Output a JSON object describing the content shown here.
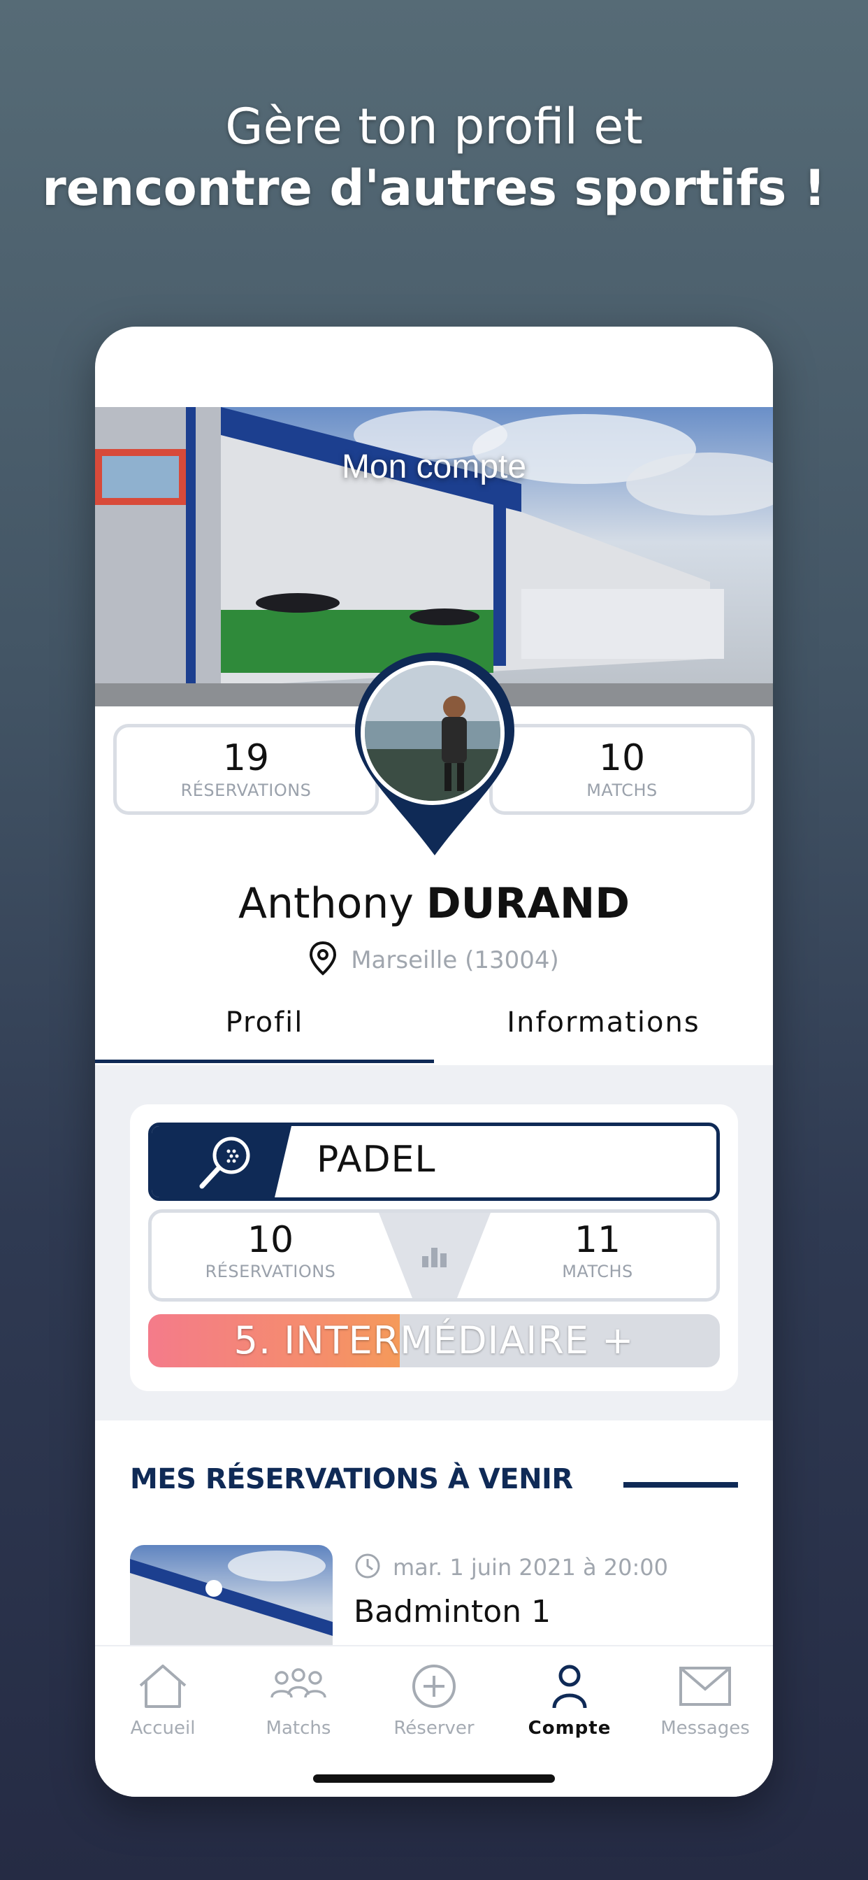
{
  "headline": {
    "line1": "Gère ton profil et",
    "line2": "rencontre d'autres sportifs !"
  },
  "cover": {
    "title": "Mon compte"
  },
  "stats": {
    "reservations": {
      "value": "19",
      "label": "RÉSERVATIONS"
    },
    "matchs": {
      "value": "10",
      "label": "MATCHS"
    }
  },
  "user": {
    "first_name": "Anthony",
    "last_name": "DURAND",
    "location": "Marseille (13004)"
  },
  "tabs": {
    "profil": "Profil",
    "informations": "Informations"
  },
  "sport": {
    "name": "PADEL",
    "icon": "padel-racket-icon",
    "reservations": {
      "value": "10",
      "label": "RÉSERVATIONS"
    },
    "matchs": {
      "value": "11",
      "label": "MATCHS"
    },
    "level": "5. INTERMÉDIAIRE +",
    "level_progress": 0.44
  },
  "upcoming": {
    "title": "MES RÉSERVATIONS À VENIR",
    "items": [
      {
        "date": "mar. 1 juin 2021 à 20:00",
        "name": "Badminton 1"
      }
    ]
  },
  "tabbar": {
    "items": [
      {
        "label": "Accueil",
        "icon": "home-icon"
      },
      {
        "label": "Matchs",
        "icon": "players-icon"
      },
      {
        "label": "Réserver",
        "icon": "plus-circle-icon"
      },
      {
        "label": "Compte",
        "icon": "user-icon",
        "active": true
      },
      {
        "label": "Messages",
        "icon": "mail-icon"
      }
    ]
  },
  "colors": {
    "navy": "#0f2a56",
    "level_gradient_start": "#f47b8a",
    "level_gradient_end": "#f59a5a"
  }
}
